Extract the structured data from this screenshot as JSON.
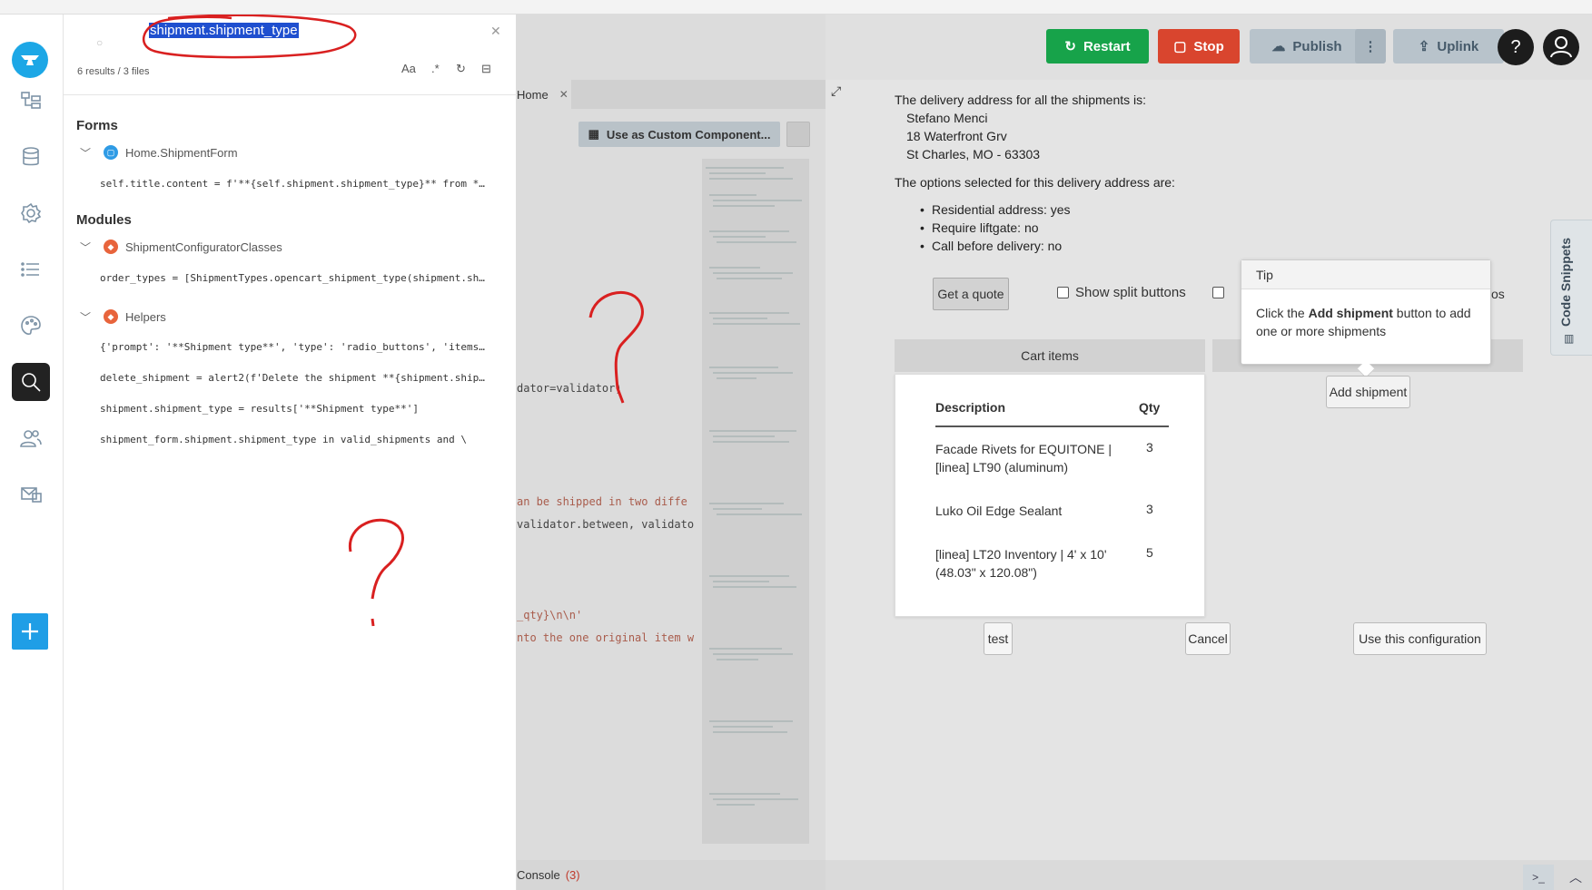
{
  "search": {
    "query": "shipment.shipment_type",
    "results_count": "6 results / 3 files",
    "options": {
      "match_case": "Aa",
      "regex": ".*"
    },
    "sections": [
      {
        "title": "Forms",
        "files": [
          {
            "name": "Home.ShipmentForm",
            "color": "#2f9be5",
            "matches": [
              "self.title.content = f'**{self.shipment.shipment_type}** from **…"
            ]
          }
        ]
      },
      {
        "title": "Modules",
        "files": [
          {
            "name": "ShipmentConfiguratorClasses",
            "color": "#e8643c",
            "matches": [
              "order_types = [ShipmentTypes.opencart_shipment_type(shipment.shi…"
            ]
          },
          {
            "name": "Helpers",
            "color": "#e8643c",
            "matches": [
              "{'prompt': '**Shipment type**', 'type': 'radio_buttons', 'items'…",
              "delete_shipment = alert2(f'Delete the shipment **{shipment.shipm…",
              "shipment.shipment_type = results['**Shipment type**']",
              "shipment_form.shipment.shipment_type in valid_shipments and \\"
            ]
          }
        ]
      }
    ]
  },
  "editor": {
    "tab": "Home",
    "custom_component_button": "Use as Custom Component...",
    "code_fragments": [
      {
        "text": "dator=validator)",
        "red": false
      },
      {
        "text": "an be shipped in two diffe",
        "red": true
      },
      {
        "text": "validator.between, validato",
        "red": false
      },
      {
        "text": "_qty}\\n\\n'",
        "red": true
      },
      {
        "text": "nto the one original item w",
        "red": true
      }
    ],
    "console_label": "Console",
    "console_count": "(3)"
  },
  "toolbar": {
    "restart": "Restart",
    "stop": "Stop",
    "publish": "Publish",
    "uplink": "Uplink",
    "help": "?"
  },
  "app": {
    "intro": "The delivery address for all the shipments is:",
    "address": [
      "Stefano Menci",
      "18 Waterfront Grv",
      "St Charles, MO - 63303"
    ],
    "options_intro": "The options selected for this delivery address are:",
    "options": [
      "Residential address: yes",
      "Require liftgate: no",
      "Call before delivery: no"
    ],
    "get_quote": "Get a quote",
    "show_split": "Show split buttons",
    "tip_title": "Tip",
    "tip_pre": "Click the ",
    "tip_bold": "Add shipment",
    "tip_post": " button to add one or more shipments",
    "tip_tail": "os",
    "cart_header": "Cart items",
    "cart_columns": {
      "description": "Description",
      "qty": "Qty"
    },
    "cart_items": [
      {
        "desc": "Facade Rivets for EQUITONE | [linea] LT90 (aluminum)",
        "qty": "3"
      },
      {
        "desc": "Luko Oil Edge Sealant",
        "qty": "3"
      },
      {
        "desc": "[linea] LT20 Inventory | 4' x 10' (48.03\" x 120.08\")",
        "qty": "5"
      }
    ],
    "add_shipment": "Add shipment",
    "test": "test",
    "cancel": "Cancel",
    "use_config": "Use this configuration",
    "code_snippets": "Code Snippets"
  },
  "colors": {
    "restart": "#17a34a",
    "stop": "#d9452e",
    "brand": "#1ca7e6",
    "annotation": "#d92020"
  }
}
